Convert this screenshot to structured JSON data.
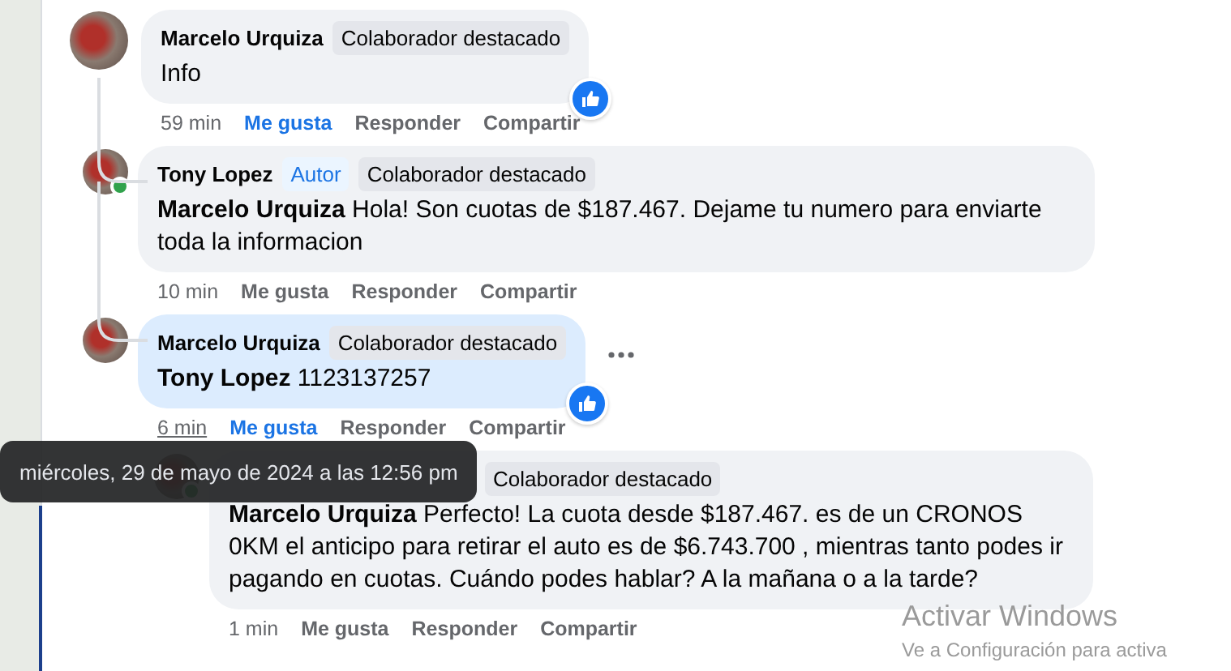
{
  "comments": [
    {
      "author": "Marcelo Urquiza",
      "badges": [
        {
          "kind": "top",
          "label": "Colaborador destacado"
        }
      ],
      "text": "Info",
      "online": false,
      "highlighted": false,
      "reacted": true,
      "more_menu": false,
      "time": "59 min",
      "time_hovered": false,
      "liked": true,
      "actions": [
        "Me gusta",
        "Responder",
        "Compartir"
      ],
      "children": [
        {
          "author": "Tony Lopez",
          "badges": [
            {
              "kind": "author",
              "label": "Autor"
            },
            {
              "kind": "top",
              "label": "Colaborador destacado"
            }
          ],
          "mention": "Marcelo Urquiza",
          "text": "Hola! Son cuotas de $187.467. Dejame tu numero para enviarte toda la informacion",
          "online": true,
          "highlighted": false,
          "reacted": false,
          "more_menu": false,
          "time": "10 min",
          "time_hovered": false,
          "liked": false,
          "actions": [
            "Me gusta",
            "Responder",
            "Compartir"
          ]
        },
        {
          "author": "Marcelo Urquiza",
          "badges": [
            {
              "kind": "top",
              "label": "Colaborador destacado"
            }
          ],
          "mention": "Tony Lopez",
          "text": "1123137257",
          "online": false,
          "highlighted": true,
          "reacted": true,
          "more_menu": true,
          "time": "6 min",
          "time_hovered": true,
          "liked": true,
          "actions": [
            "Me gusta",
            "Responder",
            "Compartir"
          ],
          "children": [
            {
              "badges": [
                {
                  "kind": "top",
                  "label": "Colaborador destacado"
                }
              ],
              "mention": "Marcelo Urquiza",
              "text": "Perfecto! La cuota desde $187.467. es de un CRONOS 0KM el anticipo para retirar el auto es de $6.743.700 , mientras tanto podes ir pagando en cuotas. Cuándo podes hablar? A la mañana o a la tarde?",
              "online": true,
              "highlighted": false,
              "reacted": false,
              "more_menu": false,
              "time": "1 min",
              "time_hovered": false,
              "liked": false,
              "actions": [
                "Me gusta",
                "Responder",
                "Compartir"
              ]
            }
          ]
        }
      ]
    }
  ],
  "tooltip": {
    "text": "miércoles, 29 de mayo de 2024 a las 12:56 pm"
  },
  "activation_notice": {
    "title": "Activar Windows",
    "subtitle": "Ve a Configuración para activa"
  }
}
